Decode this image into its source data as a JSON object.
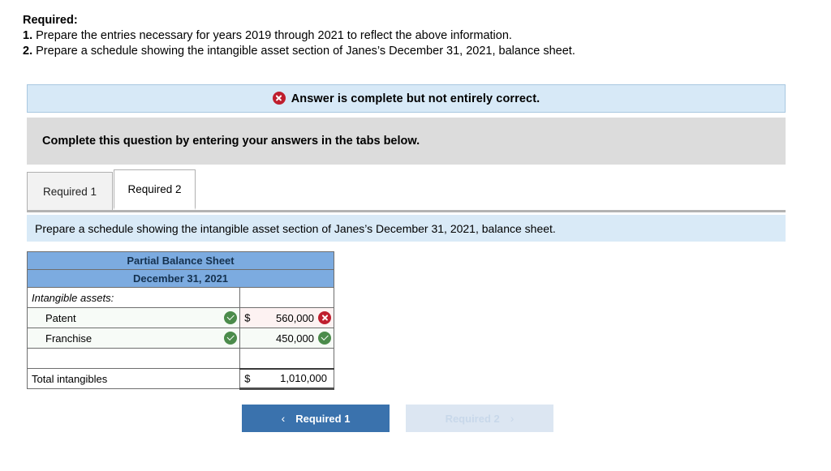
{
  "prompt": {
    "title": "Required:",
    "items": [
      {
        "num": "1.",
        "text": "Prepare the entries necessary for years 2019 through 2021 to reflect the above information."
      },
      {
        "num": "2.",
        "text": "Prepare a schedule showing the intangible asset section of Janes’s December 31, 2021, balance sheet."
      }
    ]
  },
  "alert": {
    "icon": "error-circle-icon",
    "message": "Answer is complete but not entirely correct.",
    "bg_color": "#d7e9f7",
    "icon_color": "#bf1e2e"
  },
  "gray_band": {
    "message": "Complete this question by entering your answers in the tabs below.",
    "bg_color": "#dcdcdc"
  },
  "tabs": [
    {
      "label": "Required 1",
      "active": false
    },
    {
      "label": "Required 2",
      "active": true
    }
  ],
  "sub_instruction": {
    "text": "Prepare a schedule showing the intangible asset section of Janes’s December 31, 2021, balance sheet.",
    "bg_color": "#d9eaf7"
  },
  "sheet": {
    "header_bg": "#7cabe0",
    "title_line1": "Partial Balance Sheet",
    "title_line2": "December 31, 2021",
    "rows": [
      {
        "label": "Intangible assets:",
        "style": "italic",
        "label_status": "",
        "currency": "",
        "amount": "",
        "amount_status": "",
        "amount_tint": ""
      },
      {
        "label": "Patent",
        "style": "indent",
        "label_status": "correct",
        "currency": "$",
        "amount": "560,000",
        "amount_status": "incorrect",
        "amount_tint": "bad"
      },
      {
        "label": "Franchise",
        "style": "indent",
        "label_status": "correct",
        "currency": "",
        "amount": "450,000",
        "amount_status": "correct",
        "amount_tint": "ok"
      },
      {
        "label": "",
        "style": "",
        "label_status": "",
        "currency": "",
        "amount": "",
        "amount_status": "",
        "amount_tint": ""
      }
    ],
    "total_row": {
      "label": "Total intangibles",
      "currency": "$",
      "amount": "1,010,000"
    }
  },
  "nav": {
    "prev": {
      "label": "Required 1",
      "icon": "chevron-left-icon",
      "glyph": "‹",
      "enabled": true,
      "bg_color": "#3a72ad"
    },
    "next": {
      "label": "Required 2",
      "icon": "chevron-right-icon",
      "glyph": "›",
      "enabled": false,
      "bg_color": "#dce6f2"
    }
  }
}
